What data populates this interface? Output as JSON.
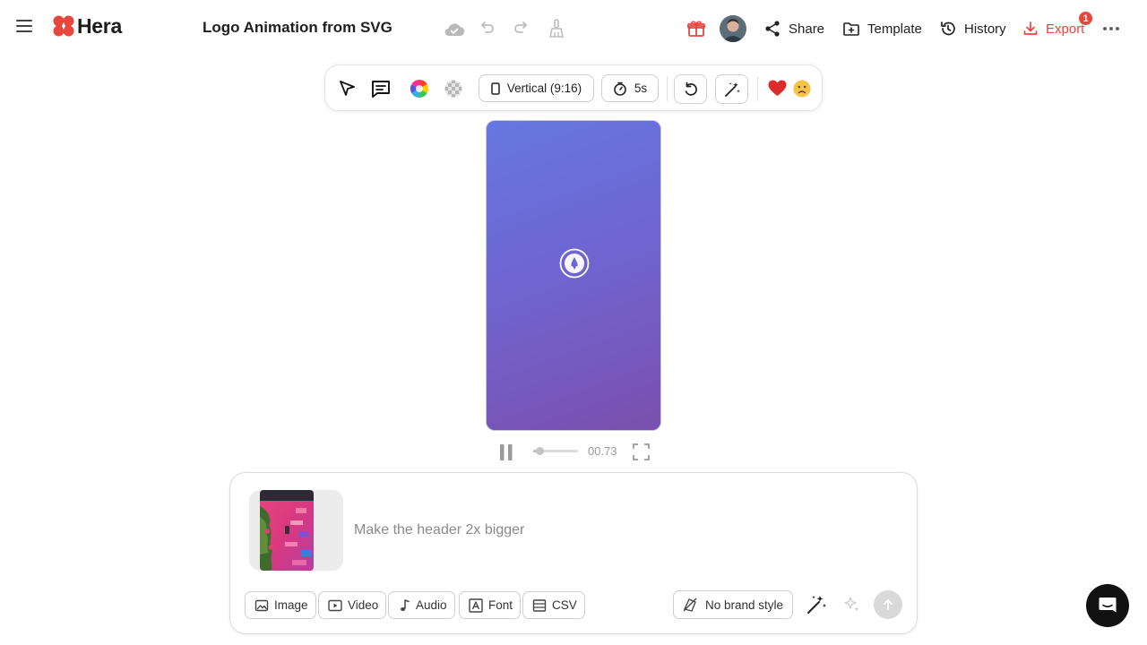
{
  "app": {
    "brand": "Hera",
    "menu_icon": "hamburger-icon",
    "logo_icon": "hera-logo-icon",
    "accent_color": "#e8453c"
  },
  "header": {
    "document_title": "Logo Animation from SVG",
    "status_icons": [
      "cloud-saved-icon",
      "undo-icon",
      "redo-icon",
      "clean-brush-icon"
    ],
    "gift_icon": "gift-icon",
    "share_label": "Share",
    "template_label": "Template",
    "history_label": "History",
    "export_label": "Export",
    "export_badge": "1",
    "more_icon": "more-horizontal-icon"
  },
  "toolbar": {
    "tools": [
      "select-cursor-icon",
      "comment-icon",
      "color-wheel-icon",
      "transparency-icon"
    ],
    "aspect_ratio_label": "Vertical (9:16)",
    "duration_label": "5s",
    "replay_icon": "replay-icon",
    "magic_icon": "magic-wand-icon",
    "feedback": [
      "heart-icon",
      "frown-icon"
    ]
  },
  "preview": {
    "gradient_start": "#6677e1",
    "gradient_end": "#7b4fae",
    "center_icon": "logo-mark-icon"
  },
  "player": {
    "pause_icon": "pause-icon",
    "progress": 0.146,
    "time": "00.73",
    "fullscreen_icon": "fullscreen-icon"
  },
  "prompt": {
    "placeholder": "Make the header 2x bigger",
    "value": "",
    "attachment_icon": "image-thumbnail",
    "chips": [
      {
        "label": "Image",
        "icon": "image-icon"
      },
      {
        "label": "Video",
        "icon": "video-icon"
      },
      {
        "label": "Audio",
        "icon": "music-note-icon"
      },
      {
        "label": "Font",
        "icon": "font-icon"
      },
      {
        "label": "CSV",
        "icon": "table-icon"
      }
    ],
    "brand_style_label": "No brand style",
    "send_icon": "arrow-up-icon"
  },
  "chat": {
    "icon": "chat-bubble-icon"
  }
}
